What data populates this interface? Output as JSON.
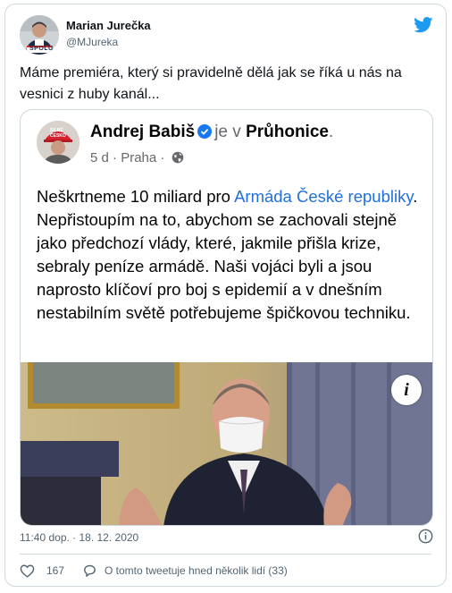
{
  "author": {
    "name": "Marian Jurečka",
    "handle": "@MJureka",
    "avatar_badge": "SPOLU"
  },
  "tweet": {
    "text": "Máme premiéra, který si pravidelně dělá jak se říká u nás na vesnici z huby kanál..."
  },
  "embed": {
    "author_name": "Andrej Babiš",
    "verb": "je v",
    "location": "Průhonice",
    "period": ".",
    "age": "5 d",
    "city": "Praha",
    "meta_sep": "·",
    "hat_text_1": "SILNÉ",
    "hat_text_2": "ČESKO",
    "post_text_1": "Neškrtneme 10 miliard pro ",
    "post_link": "Armáda České republiky",
    "post_text_2": ". Nepřistoupím na to, abychom se zachovali stejně jako předchozí vlády, které, jakmile přišla krize, sebraly peníze armádě. Naši vojáci byli a jsou naprosto klíčoví pro boj s epidemií a v dnešním nestabilním světě potřebujeme špičkovou techniku.",
    "info_label": "i"
  },
  "footer": {
    "timestamp": "11:40 dop. · 18. 12. 2020",
    "like_count": "167",
    "reply_label": "O tomto tweetuje hned několik lidí (33)"
  },
  "icons": {
    "brand": "twitter-bird-icon",
    "verified": "verified-check-icon",
    "globe": "globe-icon",
    "like": "heart-icon",
    "reply": "comment-icon",
    "info": "info-icon"
  },
  "colors": {
    "twitter_blue": "#1d9bf0",
    "facebook_link": "#216fdb",
    "verified_blue": "#1877f2",
    "muted_text": "#536471"
  }
}
